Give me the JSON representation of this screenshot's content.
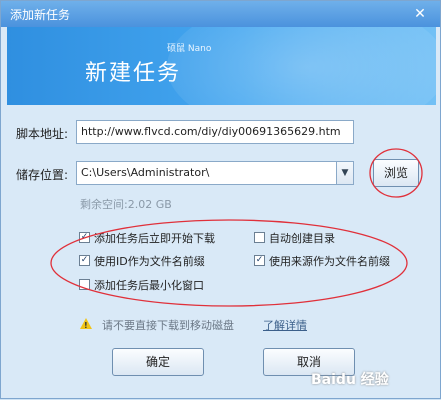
{
  "window": {
    "title": "添加新任务",
    "close_glyph": "✕"
  },
  "banner": {
    "title": "新建任务",
    "brand": "硕鼠 Nano"
  },
  "form": {
    "script_label": "脚本地址:",
    "script_value": "http://www.flvcd.com/diy/diy00691365629.htm",
    "save_label": "储存位置:",
    "save_value": "C:\\Users\\Administrator\\",
    "browse_label": "浏览",
    "free_space": "剩余空间:2.02 GB"
  },
  "options": [
    {
      "label": "添加任务后立即开始下载",
      "checked": true
    },
    {
      "label": "自动创建目录",
      "checked": false
    },
    {
      "label": "使用ID作为文件名前缀",
      "checked": true
    },
    {
      "label": "使用来源作为文件名前缀",
      "checked": true
    },
    {
      "label": "添加任务后最小化窗口",
      "checked": false
    }
  ],
  "warning": {
    "text": "请不要直接下载到移动磁盘",
    "link": "了解详情",
    "icon": "warning-icon"
  },
  "buttons": {
    "ok": "确定",
    "cancel": "取消"
  },
  "watermark": "Baidu 经验",
  "colors": {
    "annotation_circle": "#e0303a",
    "banner": "#3b9ae8"
  }
}
